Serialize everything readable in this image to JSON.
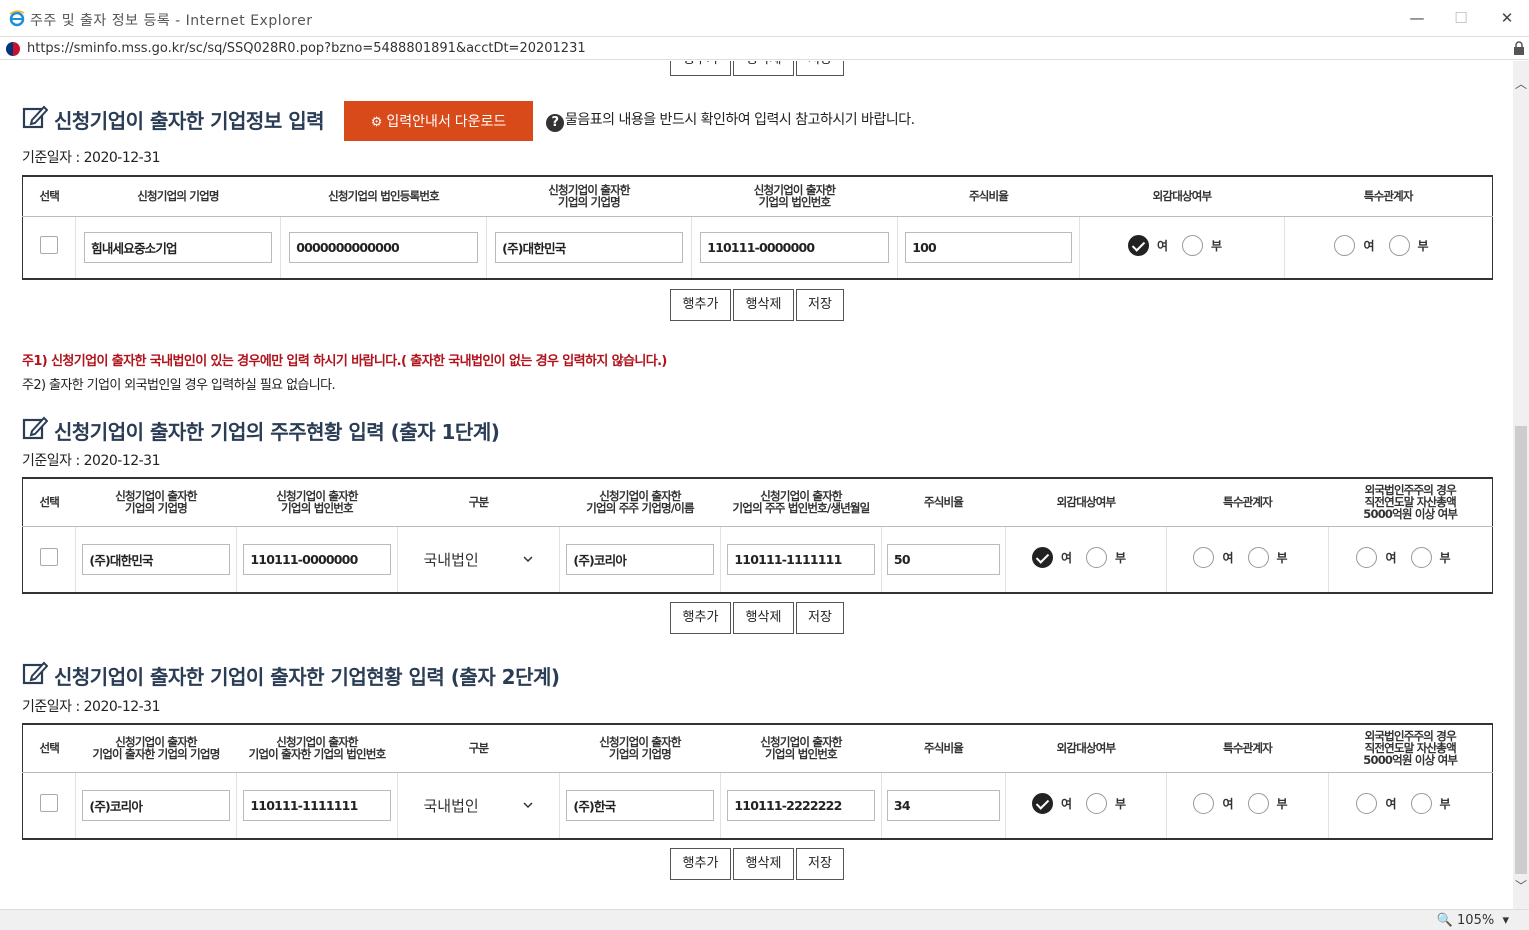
{
  "window": {
    "title": "주주 및 출자 정보 등록 - Internet Explorer",
    "url": "https://sminfo.mss.go.kr/sc/sq/SSQ028R0.pop?bzno=5488801891&acctDt=20201231",
    "zoom": "105%"
  },
  "section1": {
    "title": "신청기업이 출자한 기업정보 입력",
    "download_button": "입력안내서 다운로드",
    "help_text": "물음표의 내용을 반드시 확인하여 입력시 참고하시기 바랍니다.",
    "base_date": "기준일자 : 2020-12-31",
    "headers": [
      "선택",
      "신청기업의 기업명",
      "신청기업의 법인등록번호",
      "신청기업이 출자한\n기업의 기업명",
      "신청기업이 출자한\n기업의 법인번호",
      "주식비율",
      "외감대상여부",
      "특수관계자"
    ],
    "row": {
      "company": "힘내세요중소기업",
      "reg_no": "0000000000000",
      "invested_company": "(주)대한민국",
      "invested_corp_no": "110111-0000000",
      "share_ratio": "100",
      "audit_target": "여",
      "related_party": ""
    }
  },
  "radio_labels": {
    "yes": "여",
    "no": "부"
  },
  "row_buttons": {
    "add": "행추가",
    "delete": "행삭제",
    "save": "저장"
  },
  "notes": {
    "note1": "주1) 신청기업이 출자한 국내법인이 있는 경우에만 입력 하시기 바랍니다.( 출자한 국내법인이 없는 경우 입력하지 않습니다.)",
    "note2": "주2) 출자한 기업이 외국법인일 경우 입력하실 필요 없습니다."
  },
  "section2": {
    "title": "신청기업이 출자한 기업의 주주현황 입력 (출자 1단계)",
    "base_date": "기준일자 : 2020-12-31",
    "headers": [
      "선택",
      "신청기업이 출자한\n기업의 기업명",
      "신청기업이 출자한\n기업의 법인번호",
      "구분",
      "신청기업이 출자한\n기업의 주주 기업명/이름",
      "신청기업이 출자한\n기업의 주주 법인번호/생년월일",
      "주식비율",
      "외감대상여부",
      "특수관계자",
      "외국법인주주의 경우\n직전연도말 자산총액\n5000억원 이상 여부"
    ],
    "row": {
      "company": "(주)대한민국",
      "corp_no": "110111-0000000",
      "type": "국내법인",
      "shareholder": "(주)코리아",
      "shareholder_no": "110111-1111111",
      "share_ratio": "50",
      "audit_target": "여"
    }
  },
  "section3": {
    "title": "신청기업이 출자한 기업이 출자한 기업현황 입력 (출자 2단계)",
    "base_date": "기준일자 : 2020-12-31",
    "headers": [
      "선택",
      "신청기업이 출자한\n기업이 출자한 기업의 기업명",
      "신청기업이 출자한\n기업이 출자한 기업의 법인번호",
      "구분",
      "신청기업이 출자한\n기업의 기업명",
      "신청기업이 출자한\n기업의 법인번호",
      "주식비율",
      "외감대상여부",
      "특수관계자",
      "외국법인주주의 경우\n직전연도말 자산총액\n5000억원 이상 여부"
    ],
    "row": {
      "company": "(주)코리아",
      "corp_no": "110111-1111111",
      "type": "국내법인",
      "invested_company": "(주)한국",
      "invested_corp_no": "110111-2222222",
      "share_ratio": "34",
      "audit_target": "여"
    }
  },
  "colors": {
    "accent": "#d94a1a",
    "title": "#2b3d55",
    "note_red": "#b0131b"
  }
}
